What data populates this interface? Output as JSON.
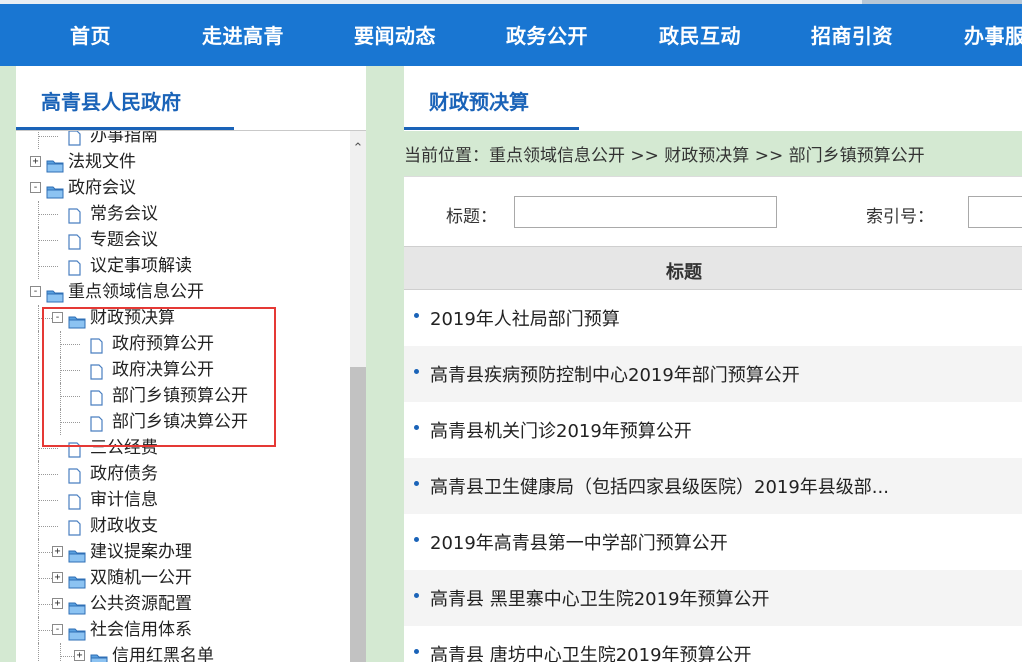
{
  "topnav": {
    "items": [
      "首页",
      "走进高青",
      "要闻动态",
      "政务公开",
      "政民互动",
      "招商引资",
      "办事服务"
    ]
  },
  "sidebar": {
    "title": "高青县人民政府",
    "tree": [
      {
        "label": "办事指南",
        "type": "doc"
      },
      {
        "label": "法规文件",
        "type": "folder",
        "expander": "+"
      },
      {
        "label": "政府会议",
        "type": "folder",
        "expander": "-"
      },
      {
        "label": "常务会议",
        "type": "doc"
      },
      {
        "label": "专题会议",
        "type": "doc"
      },
      {
        "label": "议定事项解读",
        "type": "doc"
      },
      {
        "label": "重点领域信息公开",
        "type": "folder",
        "expander": "-"
      },
      {
        "label": "财政预决算",
        "type": "folder",
        "expander": "-"
      },
      {
        "label": "政府预算公开",
        "type": "doc"
      },
      {
        "label": "政府决算公开",
        "type": "doc"
      },
      {
        "label": "部门乡镇预算公开",
        "type": "doc"
      },
      {
        "label": "部门乡镇决算公开",
        "type": "doc"
      },
      {
        "label": "三公经费",
        "type": "doc"
      },
      {
        "label": "政府债务",
        "type": "doc"
      },
      {
        "label": "审计信息",
        "type": "doc"
      },
      {
        "label": "财政收支",
        "type": "doc"
      },
      {
        "label": "建议提案办理",
        "type": "folder",
        "expander": "+"
      },
      {
        "label": "双随机一公开",
        "type": "folder",
        "expander": "+"
      },
      {
        "label": "公共资源配置",
        "type": "folder",
        "expander": "+"
      },
      {
        "label": "社会信用体系",
        "type": "folder",
        "expander": "-"
      },
      {
        "label": "信用红黑名单",
        "type": "folder",
        "expander": "+"
      }
    ]
  },
  "main": {
    "title": "财政预决算",
    "breadcrumb": "当前位置：重点领域信息公开 >> 财政预决算 >> 部门乡镇预算公开",
    "search": {
      "title_label": "标题：",
      "title_value": "",
      "index_label": "索引号：",
      "index_value": ""
    },
    "table_header": "标题",
    "items": [
      "2019年人社局部门预算",
      "高青县疾病预防控制中心2019年部门预算公开",
      "高青县机关门诊2019年预算公开",
      "高青县卫生健康局（包括四家县级医院）2019年县级部...",
      "2019年高青县第一中学部门预算公开",
      "高青县 黑里寨中心卫生院2019年预算公开",
      "高青县 唐坊中心卫生院2019年预算公开"
    ]
  },
  "colors": {
    "nav_bg": "#1976d2",
    "accent": "#1a63b8",
    "page_bg": "#d4e9d2",
    "highlight": "#e53935"
  }
}
